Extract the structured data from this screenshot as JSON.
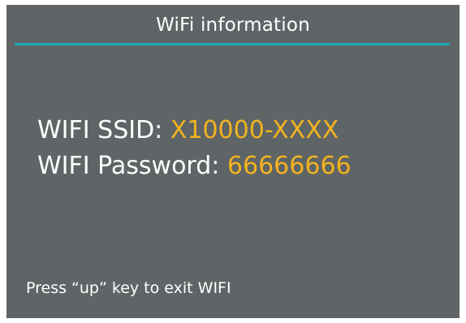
{
  "screen": {
    "title": "WiFi information",
    "ssid_label": "WIFI SSID: ",
    "ssid_value": "X10000-XXXX",
    "password_label": "WIFI Password: ",
    "password_value": "66666666",
    "hint": "Press “up” key to exit WIFI"
  },
  "colors": {
    "background": "#5f6566",
    "accent_line": "#1ea8b3",
    "value_text": "#f2b320",
    "label_text": "#ffffff"
  }
}
